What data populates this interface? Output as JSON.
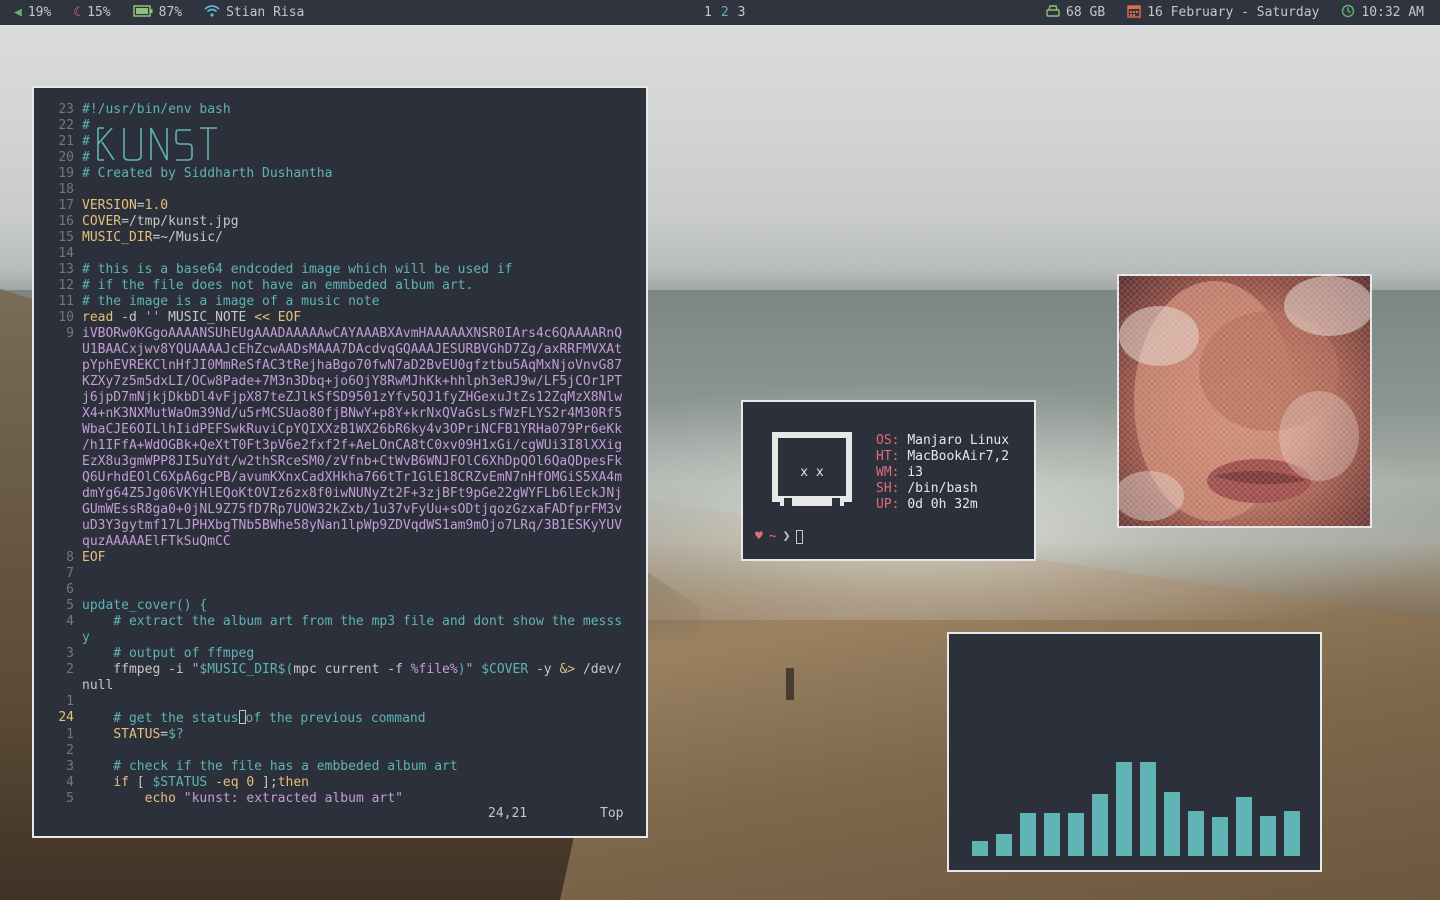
{
  "topbar": {
    "volume": "19%",
    "night": "15%",
    "battery": "87%",
    "wifi_name": "Stian Risa",
    "workspaces": [
      {
        "label": "1",
        "active": false
      },
      {
        "label": "2",
        "active": true
      },
      {
        "label": "3",
        "active": false
      }
    ],
    "disk": "68 GB",
    "date": "16 February - Saturday",
    "time": "10:32 AM"
  },
  "editor": {
    "banner_text": "KUNST",
    "lines": [
      {
        "n": "23",
        "t": "#!/usr/bin/env bash",
        "c": "c-com"
      },
      {
        "n": "22",
        "t": "#",
        "c": "c-com"
      },
      {
        "n": "21",
        "t": "#",
        "c": "c-com"
      },
      {
        "n": "20",
        "t": "#",
        "c": "c-com"
      },
      {
        "n": "19",
        "t": "# Created by Siddharth Dushantha",
        "c": "c-com"
      },
      {
        "n": "18",
        "t": "",
        "c": ""
      },
      {
        "n": "17",
        "t": "VERSION=1.0",
        "c": "assign"
      },
      {
        "n": "16",
        "t": "COVER=/tmp/kunst.jpg",
        "c": "assign"
      },
      {
        "n": "15",
        "t": "MUSIC_DIR=~/Music/",
        "c": "assign"
      },
      {
        "n": "14",
        "t": "",
        "c": ""
      },
      {
        "n": "13",
        "t": "# this is a base64 endcoded image which will be used if",
        "c": "c-com"
      },
      {
        "n": "12",
        "t": "# if the file does not have an emmbeded album art.",
        "c": "c-com"
      },
      {
        "n": "11",
        "t": "# the image is a image of a music note",
        "c": "c-com"
      },
      {
        "n": "10",
        "t": "read -d '' MUSIC_NOTE << EOF",
        "c": "read"
      },
      {
        "n": "9",
        "t": "iVBORw0KGgoAAAANSUhEUgAAADAAAAAwCAYAAABXAvmHAAAAAXNSR0IArs4c6QAAAARnQ",
        "c": "c-b64"
      },
      {
        "n": "",
        "t": "U1BAACxjwv8YQUAAAAJcEhZcwAADsMAAA7DAcdvqGQAAAJESURBVGhD7Zg/axRRFMVXAt",
        "c": "c-b64"
      },
      {
        "n": "",
        "t": "pYphEVREKClnHfJI0MmReSfAC3tRejhaBgo70fwN7aD2BvEU0gfztbu5AqMxNjoVnvG87",
        "c": "c-b64"
      },
      {
        "n": "",
        "t": "KZXy7z5m5dxLI/OCw8Pade+7M3n3Dbq+jo6OjY8RwMJhKk+hhlph3eRJ9w/LF5jCOr1PT",
        "c": "c-b64"
      },
      {
        "n": "",
        "t": "j6jpD7mNjkjDkbDl4vFjpX87teZJlkSfSD9501zYfv5QJ1fyZHGexuJtZs12ZqMzX8Nlw",
        "c": "c-b64"
      },
      {
        "n": "",
        "t": "X4+nK3NXMutWaOm39Nd/u5rMCSUao80fjBNwY+p8Y+krNxQVaGsLsfWzFLYS2r4M30Rf5",
        "c": "c-b64"
      },
      {
        "n": "",
        "t": "WbaCJE6OILlhIidPEFSwkRuviCpYQIXXzB1WX26bR6ky4v3OPriNCFB1YRHa079Pr6eKk",
        "c": "c-b64"
      },
      {
        "n": "",
        "t": "/h1IFfA+WdOGBk+QeXtT0Ft3pV6e2fxf2f+AeLOnCA8tC0xv09H1xGi/cgWUi3I8lXXig",
        "c": "c-b64"
      },
      {
        "n": "",
        "t": "EzX8u3gmWPP8JI5uYdt/w2thSRceSM0/zVfnb+CtWvB6WNJFOlC6XhDpQOl6QaQDpesFk",
        "c": "c-b64"
      },
      {
        "n": "",
        "t": "Q6UrhdEOlC6XpA6gcPB/avumKXnxCadXHkha766tTr1GlE18CRZvEmN7nHfOMGiS5XA4m",
        "c": "c-b64"
      },
      {
        "n": "",
        "t": "dmYg64Z5Jg06VKYHlEQoKtOVIz6zx8f0iwNUNyZt2F+3zjBFt9pGe22gWYFLb6lEckJNj",
        "c": "c-b64"
      },
      {
        "n": "",
        "t": "GUmWEssR8ga0+0jNL9Z75fD7Rp7UOW32kZxb/1u37vFyUu+sODtjqozGzxaFADfprFM3v",
        "c": "c-b64"
      },
      {
        "n": "",
        "t": "uD3Y3gytmf17LJPHXbgTNb5BWhe58yNan1lpWp9ZDVqdWS1am9mOjo7LRq/3B1ESKyYUV",
        "c": "c-b64"
      },
      {
        "n": "",
        "t": "quzAAAAAElFTkSuQmCC",
        "c": "c-b64"
      },
      {
        "n": "8",
        "t": "EOF",
        "c": "c-kw"
      },
      {
        "n": "7",
        "t": "",
        "c": ""
      },
      {
        "n": "6",
        "t": "",
        "c": ""
      },
      {
        "n": "5",
        "t": "update_cover() {",
        "c": "c-fn"
      },
      {
        "n": "4",
        "t": "    # extract the album art from the mp3 file and dont show the messs",
        "c": "c-com"
      },
      {
        "n": "",
        "t": "y",
        "c": "c-com"
      },
      {
        "n": "3",
        "t": "    # output of ffmpeg",
        "c": "c-com"
      },
      {
        "n": "2",
        "t": "    ffmpeg -i \"$MUSIC_DIR$(mpc current -f %file%)\" $COVER -y &> /dev/",
        "c": "ffmpeg"
      },
      {
        "n": "",
        "t": "null",
        "c": ""
      },
      {
        "n": "1",
        "t": "",
        "c": ""
      },
      {
        "n": "24",
        "t": "    # get the status of the previous command",
        "c": "c-com",
        "cur": true
      },
      {
        "n": "1",
        "t": "    STATUS=$?",
        "c": "status"
      },
      {
        "n": "2",
        "t": "",
        "c": ""
      },
      {
        "n": "3",
        "t": "    # check if the file has a embbeded album art",
        "c": "c-com"
      },
      {
        "n": "4",
        "t": "    if [ $STATUS -eq 0 ];then",
        "c": "if"
      },
      {
        "n": "5",
        "t": "        echo \"kunst: extracted album art\"",
        "c": "echo"
      }
    ],
    "status_pos": "24,21",
    "status_scroll": "Top"
  },
  "terminal": {
    "face_eyes": "x  x",
    "fetch": [
      {
        "key": "OS:",
        "val": "Manjaro Linux"
      },
      {
        "key": "HT:",
        "val": "MacBookAir7,2"
      },
      {
        "key": "WM:",
        "val": "i3"
      },
      {
        "key": "SH:",
        "val": "/bin/bash"
      },
      {
        "key": "UP:",
        "val": "0d 0h 32m"
      }
    ],
    "prompt_heart": "♥",
    "prompt_dir": "~",
    "prompt_arrow": "❯"
  },
  "visualizer": {
    "levels": [
      0.14,
      0.2,
      0.39,
      0.39,
      0.39,
      0.56,
      0.85,
      0.85,
      0.58,
      0.41,
      0.35,
      0.54,
      0.36,
      0.41
    ],
    "color": "#5fb4b3"
  },
  "colors": {
    "bar_bg": "#2f343f",
    "window_bg": "#2b303b",
    "accent_teal": "#5fb4b3",
    "accent_yellow": "#e5c07b",
    "accent_red": "#e06c75",
    "accent_purple": "#c59dd5"
  }
}
